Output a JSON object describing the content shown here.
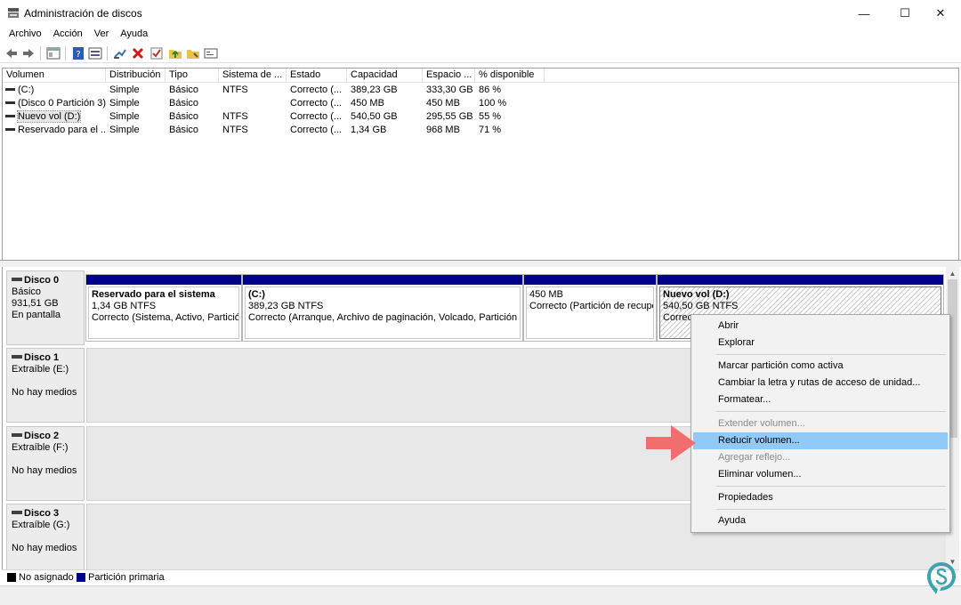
{
  "window": {
    "title": "Administración de discos",
    "minimize_glyph": "—",
    "maximize_glyph": "☐",
    "close_glyph": "✕"
  },
  "menu": [
    "Archivo",
    "Acción",
    "Ver",
    "Ayuda"
  ],
  "toolbar_icons": [
    "back-arrow-icon",
    "forward-arrow-icon",
    "console-tree-icon",
    "help-icon",
    "properties-icon",
    "connect-icon",
    "delete-icon",
    "check-icon",
    "import-folder-icon",
    "rescan-folder-icon",
    "disk-view-icon"
  ],
  "columns": [
    "Volumen",
    "Distribución",
    "Tipo",
    "Sistema de ...",
    "Estado",
    "Capacidad",
    "Espacio ...",
    "% disponible"
  ],
  "volumes": [
    {
      "name": "(C:)",
      "layout": "Simple",
      "type": "Básico",
      "fs": "NTFS",
      "status": "Correcto (...",
      "capacity": "389,23 GB",
      "free": "333,30 GB",
      "pct": "86 %"
    },
    {
      "name": "(Disco 0 Partición 3)",
      "layout": "Simple",
      "type": "Básico",
      "fs": "",
      "status": "Correcto (...",
      "capacity": "450 MB",
      "free": "450 MB",
      "pct": "100 %"
    },
    {
      "name": "Nuevo vol (D:)",
      "layout": "Simple",
      "type": "Básico",
      "fs": "NTFS",
      "status": "Correcto (...",
      "capacity": "540,50 GB",
      "free": "295,55 GB",
      "pct": "55 %"
    },
    {
      "name": "Reservado para el ...",
      "layout": "Simple",
      "type": "Básico",
      "fs": "NTFS",
      "status": "Correcto (...",
      "capacity": "1,34 GB",
      "free": "968 MB",
      "pct": "71 %"
    }
  ],
  "disks": [
    {
      "name": "Disco 0",
      "lines": [
        "Básico",
        "931,51 GB",
        "En pantalla"
      ]
    },
    {
      "name": "Disco 1",
      "lines": [
        "Extraíble (E:)",
        "",
        "No hay medios"
      ]
    },
    {
      "name": "Disco 2",
      "lines": [
        "Extraíble (F:)",
        "",
        "No hay medios"
      ]
    },
    {
      "name": "Disco 3",
      "lines": [
        "Extraíble (G:)",
        "",
        "No hay medios"
      ]
    }
  ],
  "partitions": [
    {
      "title": "Reservado para el sistema",
      "size": "1,34 GB NTFS",
      "status": "Correcto (Sistema, Activo, Partición"
    },
    {
      "title": "(C:)",
      "size": "389,23 GB NTFS",
      "status": "Correcto (Arranque, Archivo de paginación, Volcado, Partición pr"
    },
    {
      "title": "",
      "size": "450 MB",
      "status": "Correcto (Partición de recupe"
    },
    {
      "title": "Nuevo vol  (D:)",
      "size": "540,50 GB NTFS",
      "status": "Correcto"
    }
  ],
  "legend": [
    {
      "label": "No asignado",
      "color": "#000000"
    },
    {
      "label": "Partición primaria",
      "color": "#00008a"
    }
  ],
  "context_menu": {
    "items": [
      {
        "label": "Abrir",
        "enabled": true
      },
      {
        "label": "Explorar",
        "enabled": true
      },
      {
        "label": "Marcar partición como activa",
        "enabled": true
      },
      {
        "label": "Cambiar la letra y rutas de acceso de unidad...",
        "enabled": true
      },
      {
        "label": "Formatear...",
        "enabled": true
      },
      {
        "label": "Extender volumen...",
        "enabled": false
      },
      {
        "label": "Reducir volumen...",
        "enabled": true,
        "highlighted": true
      },
      {
        "label": "Agregar reflejo...",
        "enabled": false
      },
      {
        "label": "Eliminar volumen...",
        "enabled": true
      },
      {
        "label": "Propiedades",
        "enabled": true
      },
      {
        "label": "Ayuda",
        "enabled": true
      }
    ]
  },
  "colors": {
    "partition_bar": "#00008a",
    "highlight": "#91c9f7",
    "pointer_arrow": "#f26d6d",
    "watermark": "#3aa5ae"
  }
}
